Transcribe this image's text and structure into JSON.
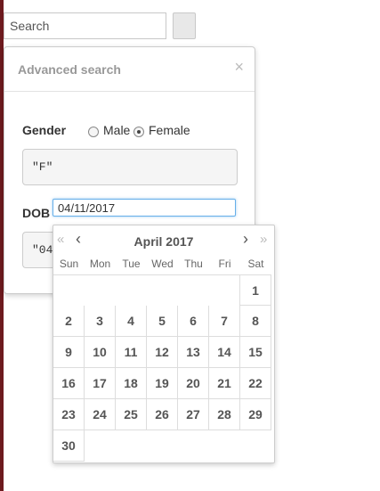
{
  "search": {
    "placeholder": "Search"
  },
  "panel": {
    "title": "Advanced search",
    "close_glyph": "×"
  },
  "gender": {
    "label": "Gender",
    "options": [
      {
        "label": "Male",
        "checked": false
      },
      {
        "label": "Female",
        "checked": true
      }
    ],
    "query": "\"F\""
  },
  "dob": {
    "label": "DOB",
    "value": "04/11/2017",
    "query_partial": "\"04"
  },
  "datepicker": {
    "month_title": "April 2017",
    "nav": {
      "prev_year": "«",
      "prev_month": "‹",
      "next_month": "›",
      "next_year": "»"
    },
    "weekdays": [
      "Sun",
      "Mon",
      "Tue",
      "Wed",
      "Thu",
      "Fri",
      "Sat"
    ],
    "weeks": [
      [
        "",
        "",
        "",
        "",
        "",
        "",
        "1"
      ],
      [
        "2",
        "3",
        "4",
        "5",
        "6",
        "7",
        "8"
      ],
      [
        "9",
        "10",
        "11",
        "12",
        "13",
        "14",
        "15"
      ],
      [
        "16",
        "17",
        "18",
        "19",
        "20",
        "21",
        "22"
      ],
      [
        "23",
        "24",
        "25",
        "26",
        "27",
        "28",
        "29"
      ],
      [
        "30",
        "",
        "",
        "",
        "",
        "",
        ""
      ]
    ]
  },
  "colors": {
    "accent_border": "#66afe9",
    "left_bar": "#6d1a1e"
  }
}
